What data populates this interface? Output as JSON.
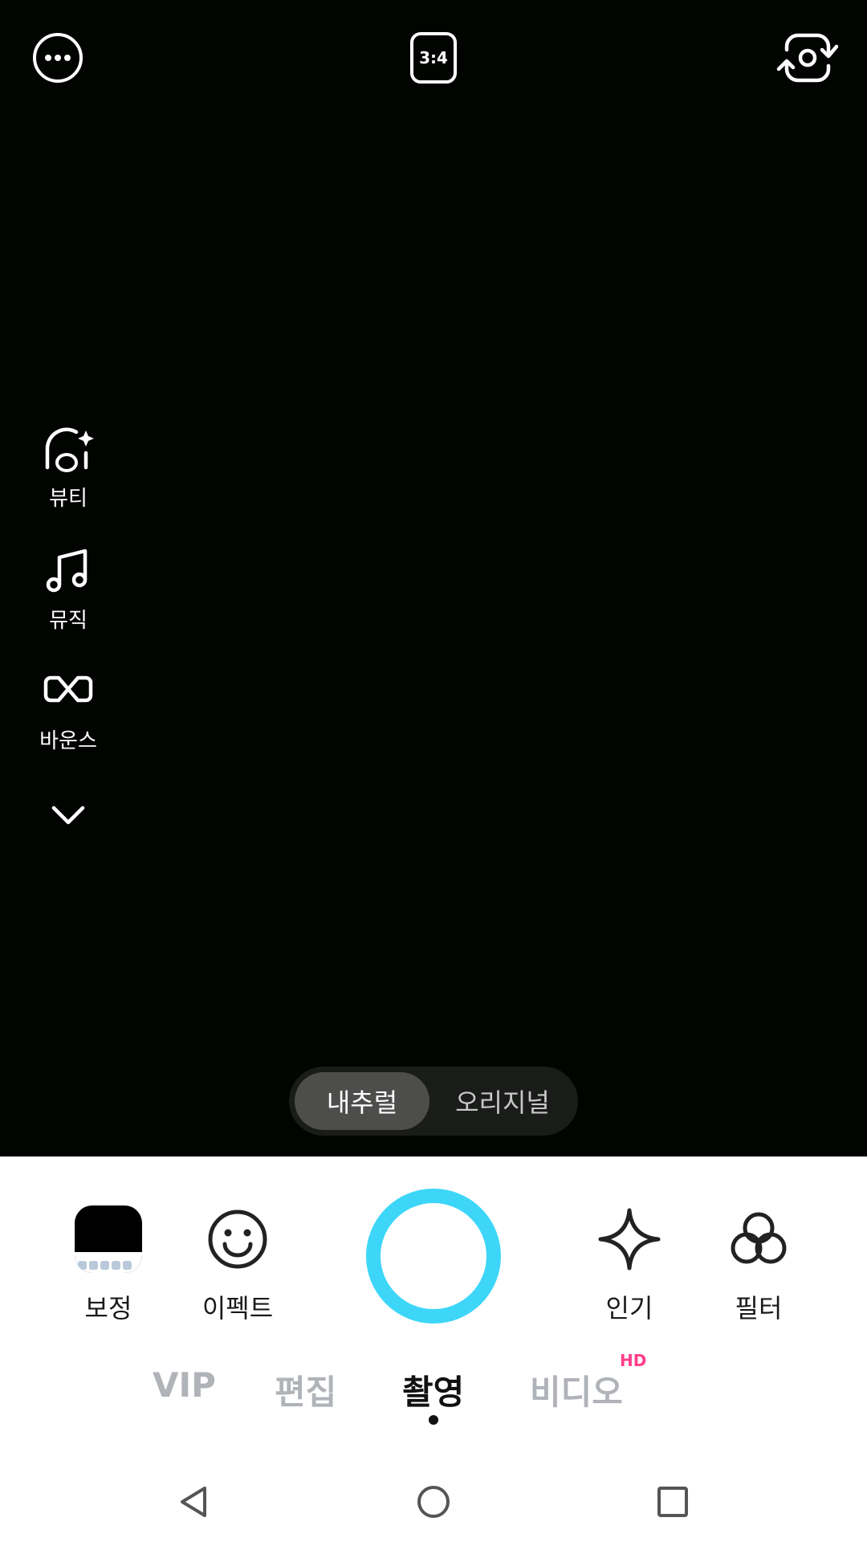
{
  "top_bar": {
    "more_icon": "more-horizontal-icon",
    "aspect_ratio": "3:4",
    "flip_icon": "camera-flip-icon"
  },
  "side_tools": [
    {
      "label": "뷰티",
      "icon": "beauty-face-sparkle-icon"
    },
    {
      "label": "뮤직",
      "icon": "music-note-icon"
    },
    {
      "label": "바운스",
      "icon": "bounce-loop-icon"
    }
  ],
  "side_more_icon": "chevron-down-icon",
  "style_toggle": {
    "options": [
      "내추럴",
      "오리지널"
    ],
    "selected": "내추럴"
  },
  "bottom_tools": {
    "retouch": "보정",
    "effect": "이펙트",
    "popular": "인기",
    "filter": "필터"
  },
  "shutter": {
    "color": "#3dd6f9"
  },
  "modes": {
    "vip": "VIP",
    "edit": "편집",
    "shoot": "촬영",
    "video": "비디오",
    "video_badge": "HD",
    "active": "촬영"
  },
  "nav": {
    "back_icon": "nav-back-icon",
    "home_icon": "nav-home-icon",
    "recent_icon": "nav-recent-icon"
  },
  "colors": {
    "accent": "#3dd6f9",
    "badge": "#ff3d8b",
    "viewfinder": "#020402"
  }
}
